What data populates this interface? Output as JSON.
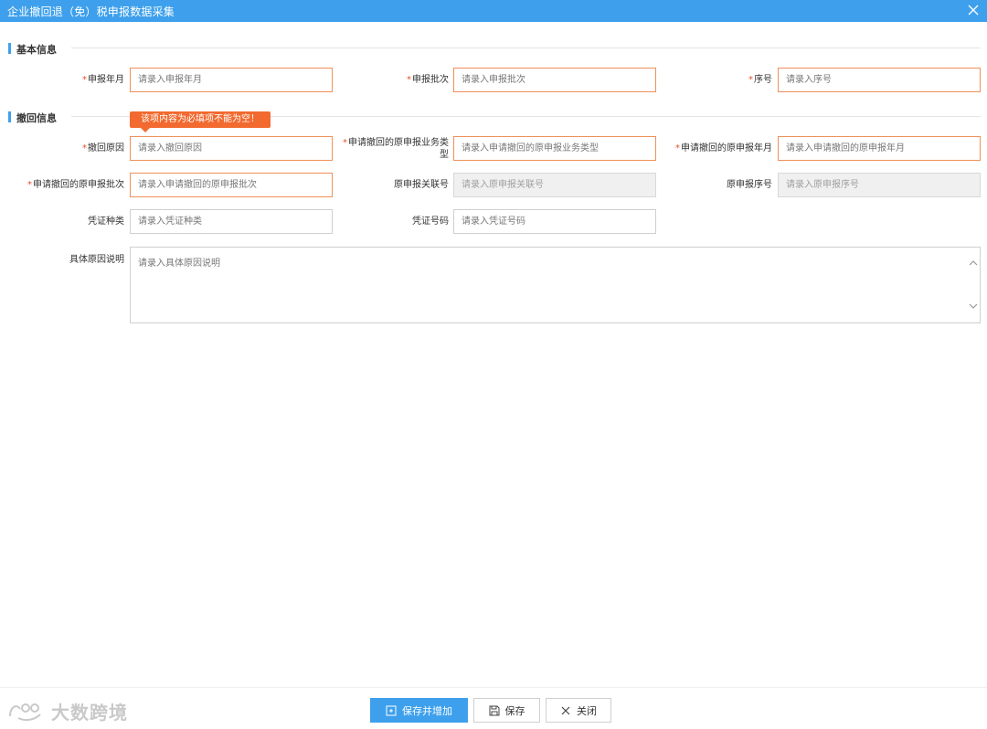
{
  "window": {
    "title": "企业撤回退（免）税申报数据采集"
  },
  "sections": {
    "basic": "基本信息",
    "withdraw": "撤回信息"
  },
  "basic": {
    "declare_month": {
      "label": "申报年月",
      "placeholder": "请录入申报年月"
    },
    "declare_batch": {
      "label": "申报批次",
      "placeholder": "请录入申报批次"
    },
    "serial_no": {
      "label": "序号",
      "placeholder": "请录入序号"
    }
  },
  "withdraw": {
    "reason": {
      "label": "撤回原因",
      "placeholder": "请录入撤回原因"
    },
    "orig_biz_type": {
      "label_line1": "申请撤回的原申报业务类",
      "label_line2": "型",
      "placeholder": "请录入申请撤回的原申报业务类型"
    },
    "orig_declare_month": {
      "label": "申请撤回的原申报年月",
      "placeholder": "请录入申请撤回的原申报年月"
    },
    "orig_declare_batch": {
      "label": "申请撤回的原申报批次",
      "placeholder": "请录入申请撤回的原申报批次"
    },
    "orig_link_no": {
      "label": "原申报关联号",
      "placeholder": "请录入原申报关联号"
    },
    "orig_serial_no": {
      "label": "原申报序号",
      "placeholder": "请录入原申报序号"
    },
    "voucher_type": {
      "label": "凭证种类",
      "placeholder": "请录入凭证种类"
    },
    "voucher_no": {
      "label": "凭证号码",
      "placeholder": "请录入凭证号码"
    },
    "detail_reason": {
      "label": "具体原因说明",
      "placeholder": "请录入具体原因说明"
    }
  },
  "validation": {
    "required_tooltip": "该项内容为必填项不能为空！"
  },
  "buttons": {
    "save_and_add": "保存并增加",
    "save": "保存",
    "close": "关闭"
  },
  "watermark": {
    "text": "大数跨境"
  },
  "colors": {
    "accent": "#3ea0ec",
    "required_border": "#f0905a",
    "tooltip_bg": "#f26a2f",
    "required_star": "#e8502d"
  },
  "icons": {
    "close": "close-icon",
    "save_and_add": "save-add-icon",
    "save": "floppy-icon",
    "close_button": "x-icon",
    "scroll_up": "chevron-up-icon",
    "scroll_down": "chevron-down-icon"
  }
}
